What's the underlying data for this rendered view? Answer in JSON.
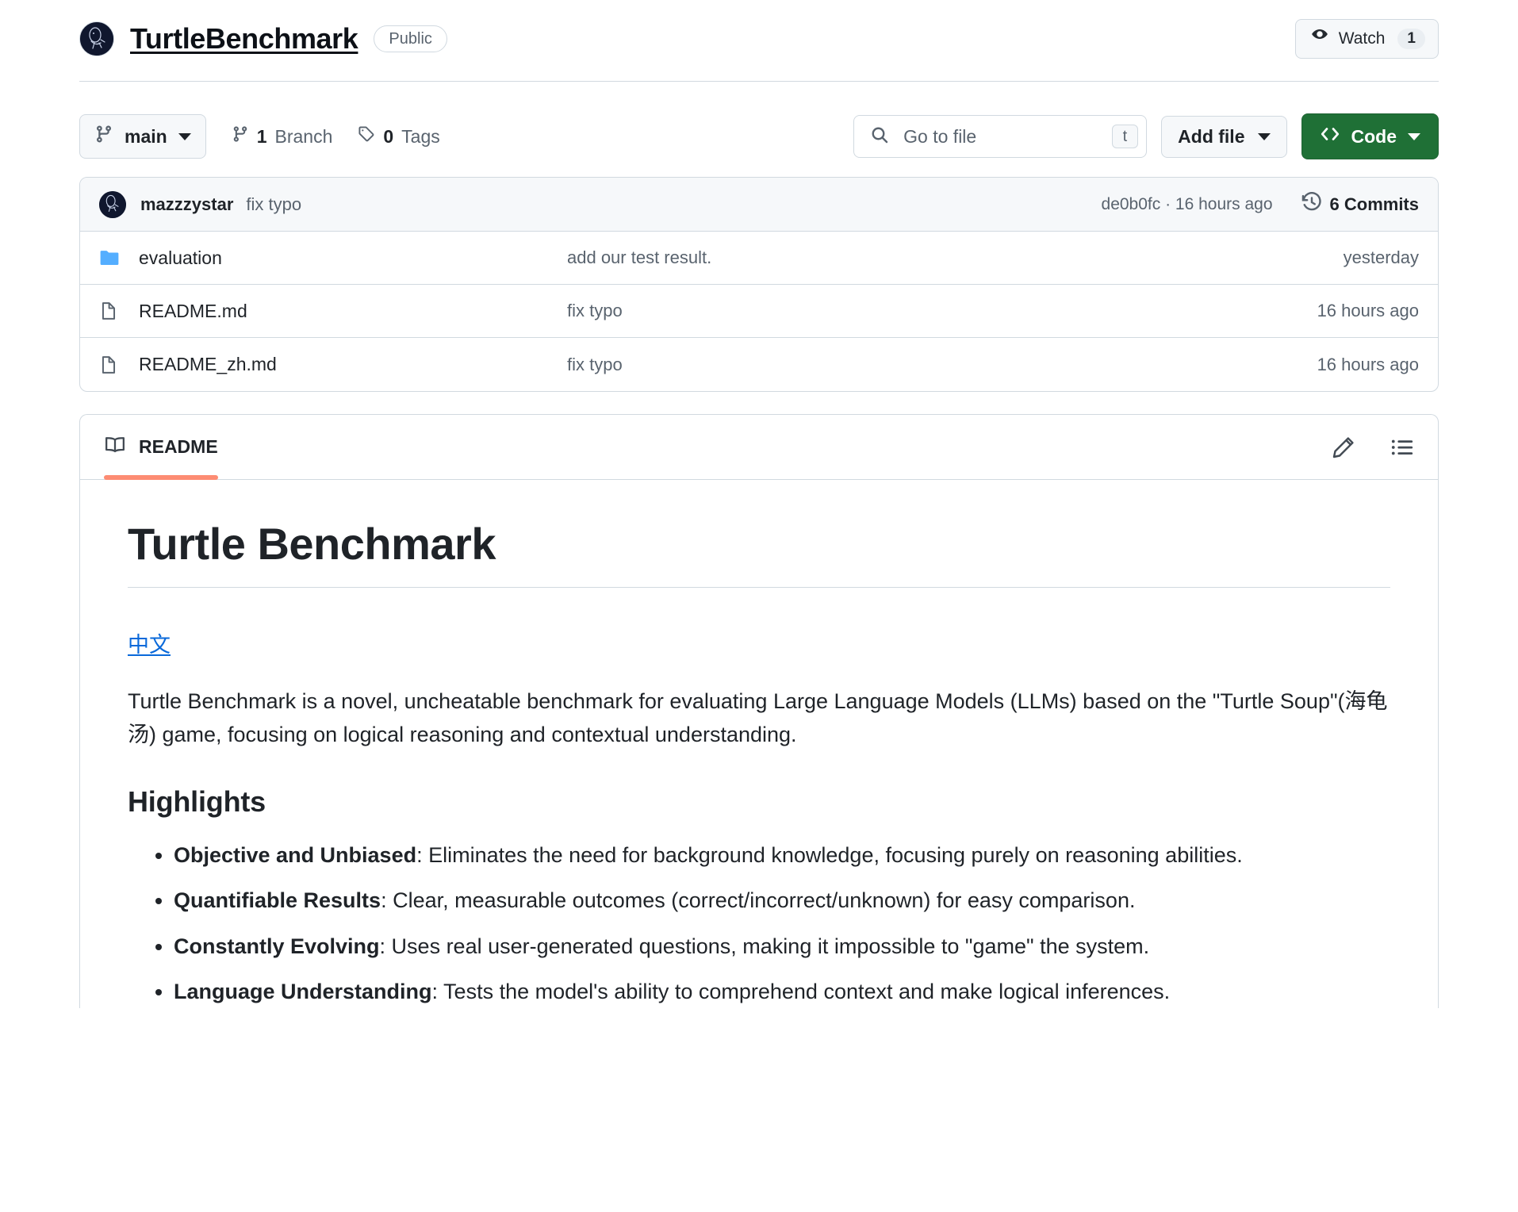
{
  "repo": {
    "name": "TurtleBenchmark",
    "visibility": "Public",
    "watch_label": "Watch",
    "watch_count": "1"
  },
  "toolbar": {
    "branch": "main",
    "branch_count": "1",
    "branch_label": "Branch",
    "tag_count": "0",
    "tag_label": "Tags",
    "search_placeholder": "Go to file",
    "search_value": "",
    "search_shortcut": "t",
    "add_file_label": "Add file",
    "code_label": "Code"
  },
  "commit_bar": {
    "author": "mazzzystar",
    "message": "fix typo",
    "hash_and_time": "de0b0fc · 16 hours ago",
    "commits_label": "6 Commits"
  },
  "files": [
    {
      "icon": "folder-icon",
      "name": "evaluation",
      "commit": "add our test result.",
      "time": "yesterday"
    },
    {
      "icon": "file-icon",
      "name": "README.md",
      "commit": "fix typo",
      "time": "16 hours ago"
    },
    {
      "icon": "file-icon",
      "name": "README_zh.md",
      "commit": "fix typo",
      "time": "16 hours ago"
    }
  ],
  "readme": {
    "tab_label": "README",
    "title": "Turtle Benchmark",
    "lang_link": "中文",
    "intro": "Turtle Benchmark is a novel, uncheatable benchmark for evaluating Large Language Models (LLMs) based on the \"Turtle Soup\"(海龟汤) game, focusing on logical reasoning and contextual understanding.",
    "highlights_heading": "Highlights",
    "highlights": [
      {
        "term": "Objective and Unbiased",
        "desc": ": Eliminates the need for background knowledge, focusing purely on reasoning abilities."
      },
      {
        "term": "Quantifiable Results",
        "desc": ": Clear, measurable outcomes (correct/incorrect/unknown) for easy comparison."
      },
      {
        "term": "Constantly Evolving",
        "desc": ": Uses real user-generated questions, making it impossible to \"game\" the system."
      },
      {
        "term": "Language Understanding",
        "desc": ": Tests the model's ability to comprehend context and make logical inferences."
      }
    ]
  },
  "colors": {
    "code_button": "#1f7036",
    "link": "#0969da",
    "tab_underline": "#fd8c73",
    "folder": "#54aeff"
  }
}
